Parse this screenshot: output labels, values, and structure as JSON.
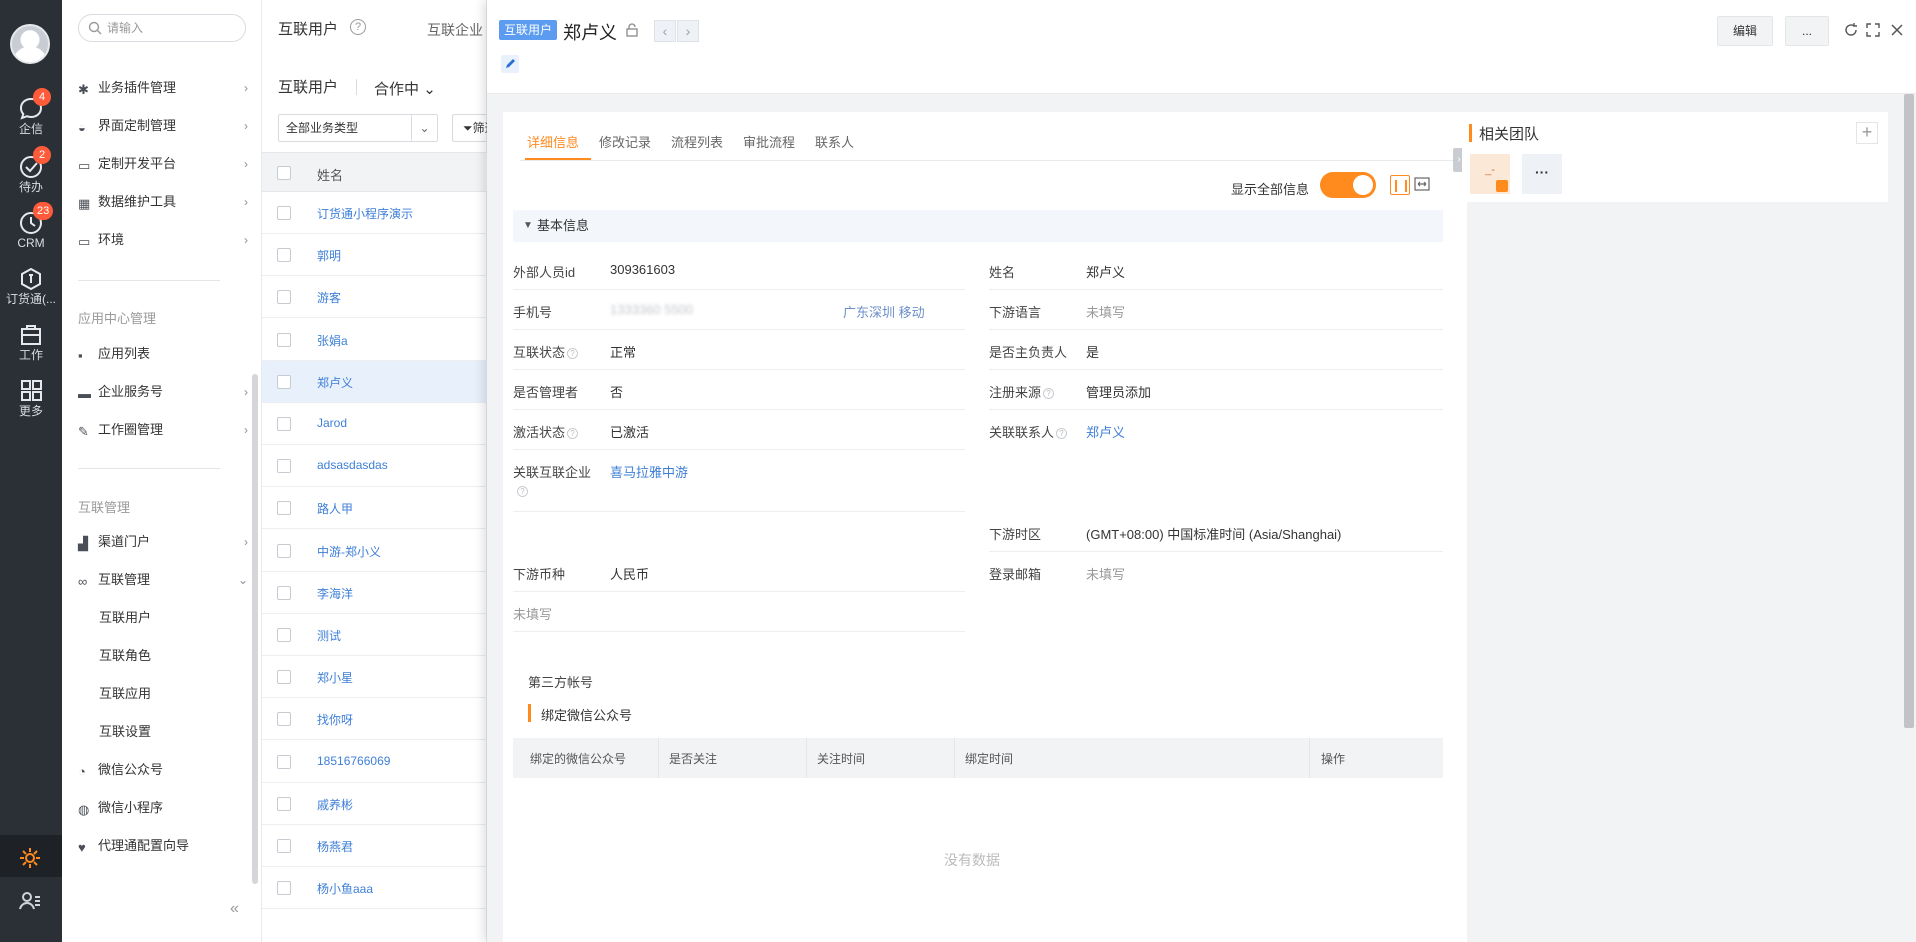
{
  "rail": {
    "items": [
      {
        "label": "企信",
        "badge": "4",
        "icon": "chat-bubble-icon"
      },
      {
        "label": "待办",
        "badge": "2",
        "icon": "check-circle-icon"
      },
      {
        "label": "CRM",
        "badge": "23",
        "icon": "clock-icon"
      },
      {
        "label": "订货通(...",
        "badge": "",
        "icon": "order-icon"
      },
      {
        "label": "工作",
        "badge": "",
        "icon": "work-icon"
      },
      {
        "label": "更多",
        "badge": "",
        "icon": "grid-icon"
      }
    ]
  },
  "menu": {
    "search_placeholder": "请输入",
    "items_top": [
      {
        "label": "业务插件管理",
        "icon": "plugin-icon"
      },
      {
        "label": "界面定制管理",
        "icon": "palette-icon"
      },
      {
        "label": "定制开发平台",
        "icon": "monitor-icon"
      },
      {
        "label": "数据维护工具",
        "icon": "data-icon"
      },
      {
        "label": "环境",
        "icon": "env-icon"
      }
    ],
    "group_app": "应用中心管理",
    "items_app": [
      {
        "label": "应用列表",
        "icon": "apps-icon",
        "chevron": false
      },
      {
        "label": "企业服务号",
        "icon": "service-icon",
        "chevron": true
      },
      {
        "label": "工作圈管理",
        "icon": "edit-icon",
        "chevron": true
      }
    ],
    "group_link": "互联管理",
    "items_link": [
      {
        "label": "渠道门户",
        "icon": "bar-chart-icon",
        "chevron": "›"
      },
      {
        "label": "互联管理",
        "icon": "link-icon",
        "chevron": "⌄"
      }
    ],
    "sub_items": [
      "互联用户",
      "互联角色",
      "互联应用",
      "互联设置"
    ],
    "items_bottom": [
      {
        "label": "微信公众号",
        "icon": "wechat-icon"
      },
      {
        "label": "微信小程序",
        "icon": "miniprogram-icon"
      },
      {
        "label": "代理通配置向导",
        "icon": "heart-icon"
      }
    ],
    "collapse_icon": "«"
  },
  "list": {
    "crumb1": "互联用户",
    "crumb2": "互联企业",
    "title": "互联用户",
    "status": "合作中",
    "status_arrow": "⌄",
    "select_value": "全部业务类型",
    "filter_label": "筛选",
    "column_name": "姓名",
    "rows": [
      "订货通小程序演示",
      "郭明",
      "游客",
      "张娟a",
      "郑卢义",
      "Jarod",
      "adsasdasdas",
      "路人甲",
      "中游-郑小义",
      "李海洋",
      "测试",
      "郑小星",
      "找你呀",
      "18516766069",
      "戚养彬",
      "杨燕君",
      "杨小鱼aaa"
    ],
    "selected_index": 4
  },
  "detail": {
    "tag": "互联用户",
    "name": "郑卢义",
    "edit_label": "编辑",
    "more_label": "...",
    "tabs": [
      "详细信息",
      "修改记录",
      "流程列表",
      "审批流程",
      "联系人"
    ],
    "active_tab": 0,
    "show_all_label": "显示全部信息",
    "show_all_on": true,
    "section_title": "基本信息",
    "fields_left": [
      {
        "label": "外部人员id",
        "value": "309361603",
        "style": ""
      },
      {
        "label": "手机号",
        "value": "1333360 5500",
        "style": "blur",
        "extra": "广东深圳 移动"
      },
      {
        "label": "互联状态",
        "value": "正常",
        "style": "",
        "help": true
      },
      {
        "label": "是否管理者",
        "value": "否",
        "style": ""
      },
      {
        "label": "激活状态",
        "value": "已激活",
        "style": "",
        "help": true
      },
      {
        "label": "关联互联企业",
        "value": "喜马拉雅中游",
        "style": "link",
        "help": true
      },
      {
        "label": "下游币种",
        "value": "人民币",
        "style": ""
      },
      {
        "label": "未填写",
        "value": "",
        "style": ""
      }
    ],
    "fields_right": [
      {
        "label": "姓名",
        "value": "郑卢义",
        "style": ""
      },
      {
        "label": "下游语言",
        "value": "未填写",
        "style": "muted"
      },
      {
        "label": "是否主负责人",
        "value": "是",
        "style": ""
      },
      {
        "label": "注册来源",
        "value": "管理员添加",
        "style": "",
        "help": true
      },
      {
        "label": "关联联系人",
        "value": "郑卢义",
        "style": "link",
        "help": true
      },
      {
        "label": "下游时区",
        "value": "(GMT+08:00) 中国标准时间 (Asia/Shanghai)",
        "style": ""
      },
      {
        "label": "登录邮箱",
        "value": "未填写",
        "style": "muted"
      }
    ],
    "third_party_title": "第三方帐号",
    "wechat_title": "绑定微信公众号",
    "table_columns": [
      "绑定的微信公众号",
      "是否关注",
      "关注时间",
      "绑定时间",
      "操作"
    ],
    "empty_text": "没有数据",
    "team_title": "相关团队",
    "team_member_initial": "_-",
    "accent_color": "#ff8a1e",
    "link_color": "#3e7fd7"
  }
}
